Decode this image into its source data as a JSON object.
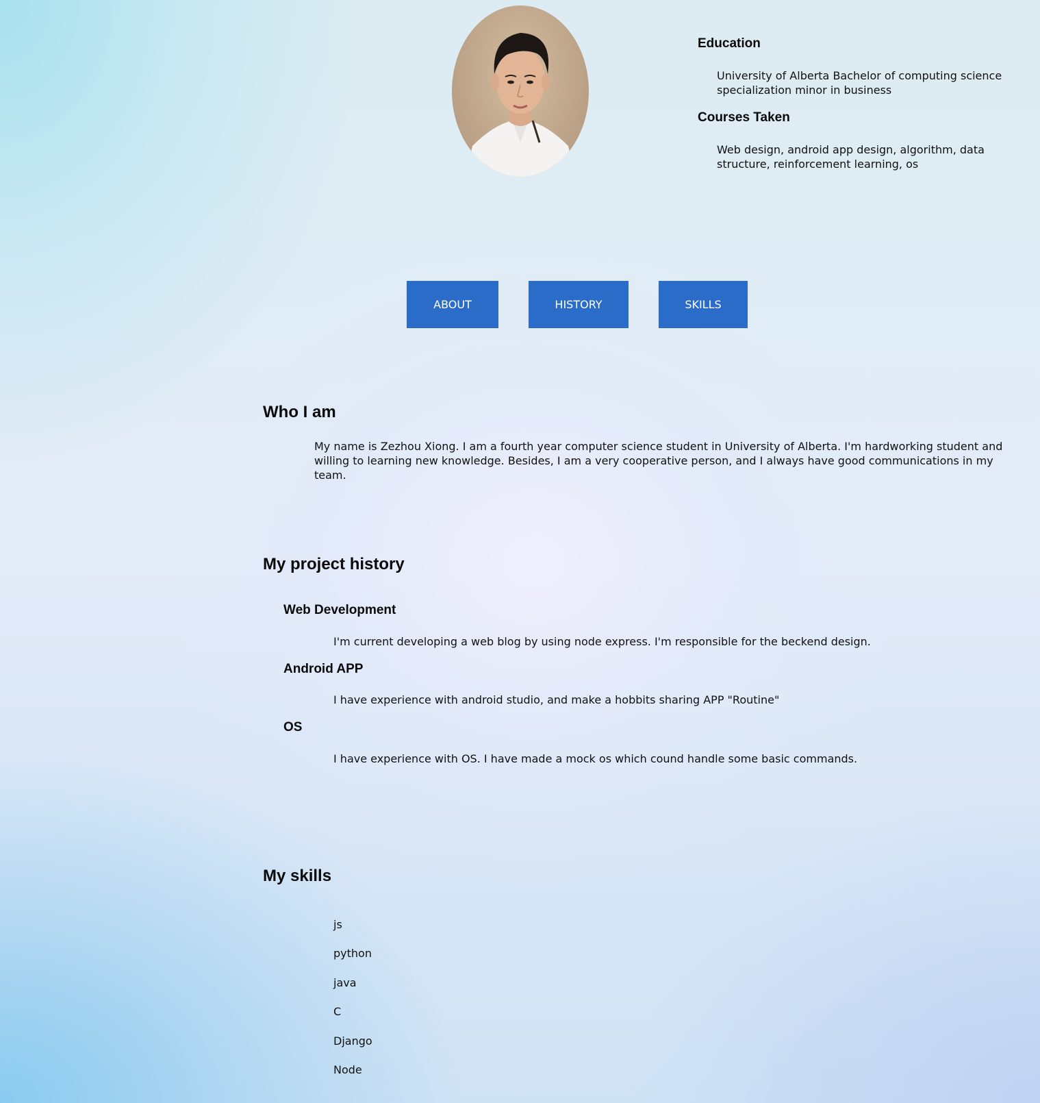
{
  "profile": {
    "photo_alt": "avatar"
  },
  "education": {
    "title": "Education",
    "text": "University of Alberta Bachelor of computing science specialization minor in business"
  },
  "courses": {
    "title": "Courses Taken",
    "text": "Web design, android app design, algorithm, data structure, reinforcement learning, os"
  },
  "nav": {
    "about": "ABOUT",
    "history": "HISTORY",
    "skills": "SKILLS"
  },
  "about": {
    "title": "Who I am",
    "text": "My name is Zezhou Xiong. I am a fourth year computer science student in University of Alberta. I'm hardworking student and willing to learning new knowledge. Besides, I am a very cooperative person, and I always have good communications in my team."
  },
  "history": {
    "title": "My project history",
    "projects": [
      {
        "title": "Web Development",
        "text": "I'm current developing a web blog by using node express. I'm responsible for the beckend design."
      },
      {
        "title": "Android APP",
        "text": "I have experience with android studio, and make a hobbits sharing APP \"Routine\""
      },
      {
        "title": "OS",
        "text": "I have experience with OS. I have made a mock os which cound handle some basic commands."
      }
    ]
  },
  "skills": {
    "title": "My skills",
    "items": [
      "js",
      "python",
      "java",
      "C",
      "Django",
      "Node"
    ]
  },
  "colors": {
    "button": "#2a6cc8",
    "button_text": "#ffffff"
  }
}
